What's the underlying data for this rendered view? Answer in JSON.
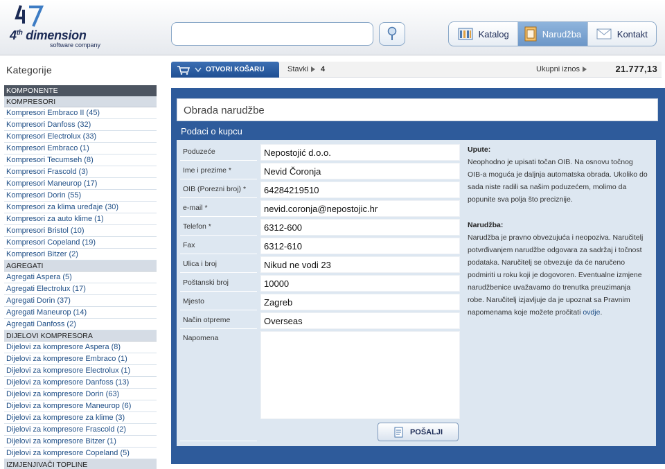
{
  "header": {
    "brand_number": "4",
    "brand_suffix": "th",
    "brand_name": "dimension",
    "brand_tagline": "software company",
    "search": {
      "value": "",
      "placeholder": ""
    },
    "nav": [
      {
        "label": "Katalog",
        "icon": "catalog-icon"
      },
      {
        "label": "Narudžba",
        "icon": "order-icon",
        "active": true
      },
      {
        "label": "Kontakt",
        "icon": "envelope-icon"
      }
    ]
  },
  "sidebar": {
    "title": "Kategorije",
    "entries": [
      {
        "type": "head-dark",
        "label": "KOMPONENTE"
      },
      {
        "type": "head",
        "label": "KOMPRESORI"
      },
      {
        "type": "item",
        "label": "Kompresori Embraco II (45)"
      },
      {
        "type": "item",
        "label": "Kompresori Danfoss (32)"
      },
      {
        "type": "item",
        "label": "Kompresori Electrolux (33)"
      },
      {
        "type": "item",
        "label": "Kompresori Embraco (1)"
      },
      {
        "type": "item",
        "label": "Kompresori Tecumseh (8)"
      },
      {
        "type": "item",
        "label": "Kompresori Frascold (3)"
      },
      {
        "type": "item",
        "label": "Kompresori Maneurop (17)"
      },
      {
        "type": "item",
        "label": "Kompresori Dorin (55)"
      },
      {
        "type": "item",
        "label": "Kompresori za klima uređaje (30)"
      },
      {
        "type": "item",
        "label": "Kompresori za auto klime (1)"
      },
      {
        "type": "item",
        "label": "Kompresori Bristol (10)"
      },
      {
        "type": "item",
        "label": "Kompresori Copeland (19)"
      },
      {
        "type": "item",
        "label": "Kompresori Bitzer (2)"
      },
      {
        "type": "head",
        "label": "AGREGATI"
      },
      {
        "type": "item",
        "label": "Agregati Aspera (5)"
      },
      {
        "type": "item",
        "label": "Agregati Electrolux (17)"
      },
      {
        "type": "item",
        "label": "Agregati Dorin (37)"
      },
      {
        "type": "item",
        "label": "Agregati Maneurop (14)"
      },
      {
        "type": "item",
        "label": "Agregati Danfoss (2)"
      },
      {
        "type": "head",
        "label": "DIJELOVI KOMPRESORA"
      },
      {
        "type": "item",
        "label": "Dijelovi za kompresore Aspera (8)"
      },
      {
        "type": "item",
        "label": "Dijelovi za kompresore Embraco (1)"
      },
      {
        "type": "item",
        "label": "Dijelovi za kompresore Electrolux (1)"
      },
      {
        "type": "item",
        "label": "Dijelovi za kompresore Danfoss (13)"
      },
      {
        "type": "item",
        "label": "Dijelovi za kompresore Dorin (63)"
      },
      {
        "type": "item",
        "label": "Dijelovi za kompresore Maneurop (6)"
      },
      {
        "type": "item",
        "label": "Dijelovi za kompresore za klime (3)"
      },
      {
        "type": "item",
        "label": "Dijelovi za kompresore Frascold (2)"
      },
      {
        "type": "item",
        "label": "Dijelovi za kompresore Bitzer (1)"
      },
      {
        "type": "item",
        "label": "Dijelovi za kompresore Copeland (5)"
      },
      {
        "type": "head",
        "label": "IZMJENJIVAČI TOPLINE"
      }
    ]
  },
  "cart": {
    "button_label": "OTVORI KOŠARU",
    "items_label": "Stavki",
    "items_count": "4",
    "total_label": "Ukupni iznos",
    "total_value": "21.777,13"
  },
  "order": {
    "title": "Obrada narudžbe",
    "section_title": "Podaci o kupcu",
    "fields": [
      {
        "name": "company-field",
        "label": "Poduzeće",
        "value": "Nepostojić d.o.o."
      },
      {
        "name": "full-name-field",
        "label": "Ime i prezime *",
        "value": "Nevid Čoronja"
      },
      {
        "name": "oib-field",
        "label": "OIB (Porezni broj) *",
        "value": "64284219510"
      },
      {
        "name": "email-field",
        "label": "e-mail *",
        "value": "nevid.coronja@nepostojic.hr"
      },
      {
        "name": "phone-field",
        "label": "Telefon *",
        "value": "6312-600"
      },
      {
        "name": "fax-field",
        "label": "Fax",
        "value": "6312-610"
      },
      {
        "name": "street-field",
        "label": "Ulica i broj",
        "value": "Nikud ne vodi 23"
      },
      {
        "name": "postal-code-field",
        "label": "Poštanski broj",
        "value": "10000"
      },
      {
        "name": "city-field",
        "label": "Mjesto",
        "value": "Zagreb"
      },
      {
        "name": "shipping-method-field",
        "label": "Način otpreme",
        "value": "Overseas"
      }
    ],
    "note_label": "Napomena",
    "note_value": "",
    "submit_label": "POŠALJI"
  },
  "info": {
    "upute_title": "Upute:",
    "upute_text": "Neophodno je upisati točan OIB. Na osnovu točnog OIB-a moguća je daljnja automatska obrada. Ukoliko do sada niste radili sa našim poduzećem, molimo da popunite sva polja što preciznije.",
    "narudzba_title": "Narudžba:",
    "narudzba_text": "Narudžba je pravno obvezujuća i neopoziva. Naručitelj potvrđivanjem narudžbe odgovara za sadržaj i točnost podataka. Naručitelj se obvezuje da će naručeno podmiriti u roku koji je dogovoren. Eventualne izmjene narudžbenice uvažavamo do trenutka preuzimanja robe. Naručitelj izjavljuje da je upoznat sa Pravnim napomenama koje možete pročitati",
    "link_label": "ovdje",
    "trailing": "."
  },
  "colors": {
    "panel_blue": "#2e5b9b",
    "form_bg": "#dde7f1",
    "link_blue": "#1e4e86",
    "brand_navy": "#1b2a55"
  }
}
